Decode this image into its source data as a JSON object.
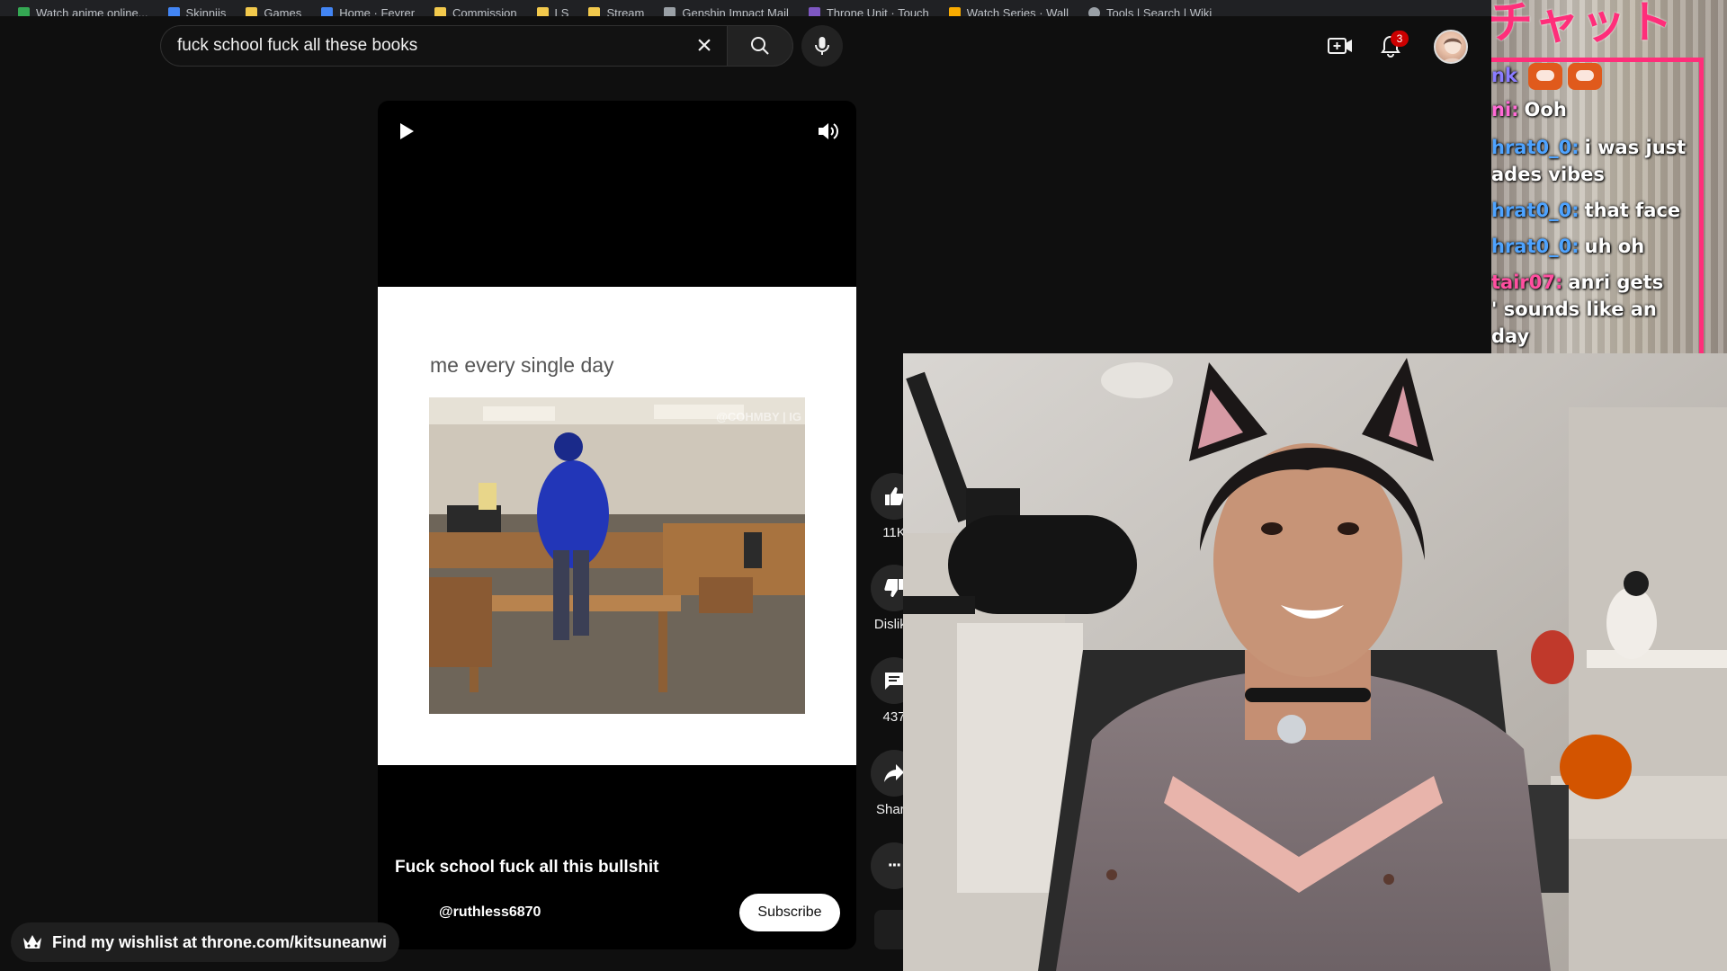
{
  "bookmarks": [
    {
      "label": "Watch anime online..."
    },
    {
      "label": "Skinnijs"
    },
    {
      "label": "Games"
    },
    {
      "label": "Home · Feyrer"
    },
    {
      "label": "Commission"
    },
    {
      "label": "LS"
    },
    {
      "label": "Stream"
    },
    {
      "label": "Genshin Impact Mail"
    },
    {
      "label": "Throne Unit · Touch"
    },
    {
      "label": "Watch Series · Wall"
    },
    {
      "label": "Tools | Search | Wiki"
    }
  ],
  "search": {
    "value": "fuck school fuck all these books",
    "clear_symbol": "×"
  },
  "header": {
    "notification_count": "3"
  },
  "short": {
    "meme_caption": "me every single day",
    "watermark": "@COHMBY | IG",
    "title": "Fuck school fuck all this bullshit",
    "channel": "@ruthless6870",
    "subscribe_label": "Subscribe"
  },
  "actions": {
    "like_count": "11K",
    "dislike_label": "Dislike",
    "comment_count": "437",
    "share_label": "Share",
    "more_symbol": "···"
  },
  "overlay": {
    "wishlist_text": "Find my wishlist at throne.com/kitsuneanwi"
  },
  "chat": {
    "header": "チャット",
    "lines": [
      {
        "name": "nk",
        "text": "",
        "color": "#8a7cff",
        "emotes": 2
      },
      {
        "name": "ni:",
        "text": "Ooh",
        "color": "#ff6ad5",
        "emotes": 0
      },
      {
        "name": "hrat0_0:",
        "text": "i was just",
        "color": "#4ea3ff",
        "emotes": 0
      },
      {
        "name": "",
        "text": "ades vibes",
        "color": "#ffffff",
        "emotes": 0
      },
      {
        "name": "hrat0_0:",
        "text": "that face",
        "color": "#4ea3ff",
        "emotes": 0
      },
      {
        "name": "hrat0_0:",
        "text": "uh oh",
        "color": "#4ea3ff",
        "emotes": 0
      },
      {
        "name": "tair07:",
        "text": "anri gets",
        "color": "#ff4fa0",
        "emotes": 0
      },
      {
        "name": "",
        "text": "' sounds like an",
        "color": "#ffffff",
        "emotes": 0
      },
      {
        "name": "",
        "text": "day",
        "color": "#ffffff",
        "emotes": 0
      }
    ]
  },
  "colors": {
    "background": "#0f0f0f",
    "accent_pink": "#ff2e7a",
    "notification_red": "#cc0000"
  },
  "icons": [
    "search-icon",
    "mic-icon",
    "create-icon",
    "bell-icon",
    "play-icon",
    "volume-icon",
    "thumbs-up-icon",
    "thumbs-down-icon",
    "comment-icon",
    "share-icon",
    "more-icon",
    "crown-icon"
  ]
}
